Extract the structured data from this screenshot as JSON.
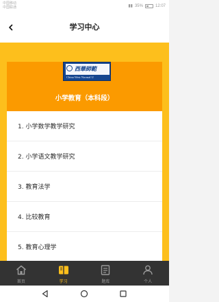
{
  "status_bar": {
    "carrier": "中国移动\n中国联通",
    "battery": "35%",
    "time": "12:07"
  },
  "header": {
    "title": "学习中心"
  },
  "course": {
    "logo_text": "西華師範",
    "logo_subtext": "China West Normal U",
    "title": "小学教育（本科段）"
  },
  "subjects": [
    "1. 小学数学教学研究",
    "2. 小学语文教学研究",
    "3. 教育法学",
    "4. 比较教育",
    "5. 教育心理学"
  ],
  "tabbar": {
    "items": [
      {
        "label": "首页",
        "icon": "home-icon"
      },
      {
        "label": "学习",
        "icon": "book-icon"
      },
      {
        "label": "题库",
        "icon": "document-icon"
      },
      {
        "label": "个人",
        "icon": "person-icon"
      }
    ],
    "active_index": 1
  },
  "colors": {
    "accent": "#fdbf1c",
    "card_header": "#fb9a00",
    "tabbar": "#333333"
  }
}
